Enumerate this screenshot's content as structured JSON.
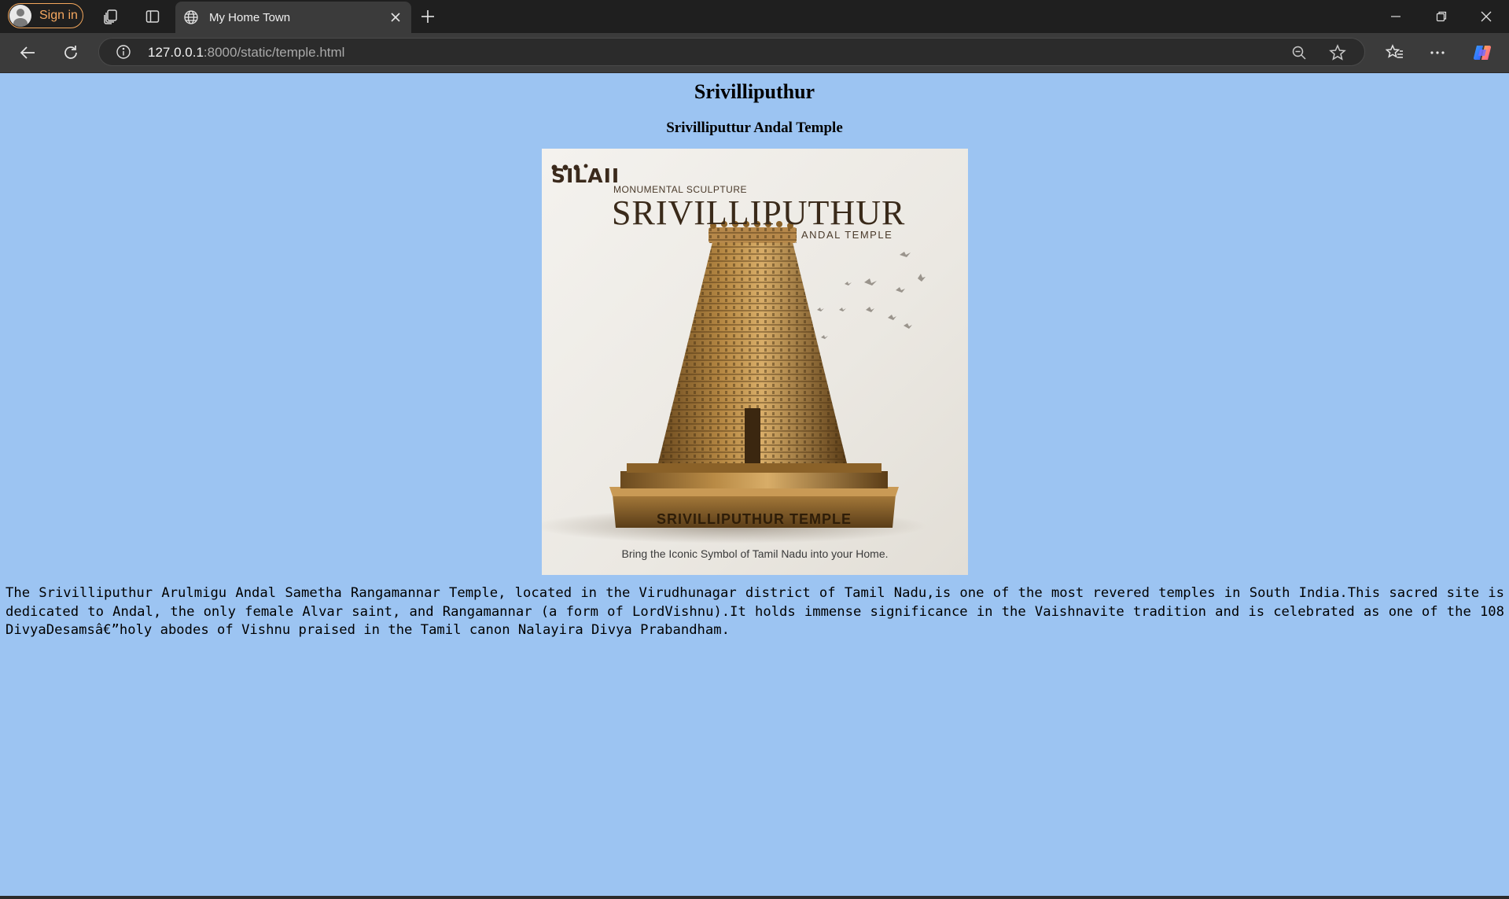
{
  "browser": {
    "signin_label": "Sign in",
    "tab_title": "My Home Town",
    "url_host": "127.0.0.1",
    "url_rest": ":8000/static/temple.html"
  },
  "page": {
    "title": "Srivilliputhur",
    "subtitle": "Srivilliputtur Andal Temple",
    "image": {
      "brand": "SILAII",
      "eyebrow": "MONUMENTAL SCULPTURE",
      "name": "SRIVILLIPUTHUR",
      "subname": "ANDAL TEMPLE",
      "plaque": "SRIVILLIPUTHUR TEMPLE",
      "caption": "Bring the Iconic Symbol of Tamil Nadu into your Home."
    },
    "description": "The Srivilliputhur Arulmigu Andal Sametha Rangamannar Temple, located in the Virudhunagar district of Tamil Nadu,is one of the most revered temples in South India.This sacred site is dedicated to Andal, the only female Alvar saint, and Rangamannar (a form of LordVishnu).It holds immense significance in the Vaishnavite tradition and is celebrated as one of the 108 DivyaDesamsâ€”holy abodes of Vishnu praised in the Tamil canon Nalayira Divya Prabandham."
  },
  "colors": {
    "page_background": "#9cc4f2",
    "accent": "#f5a860"
  }
}
